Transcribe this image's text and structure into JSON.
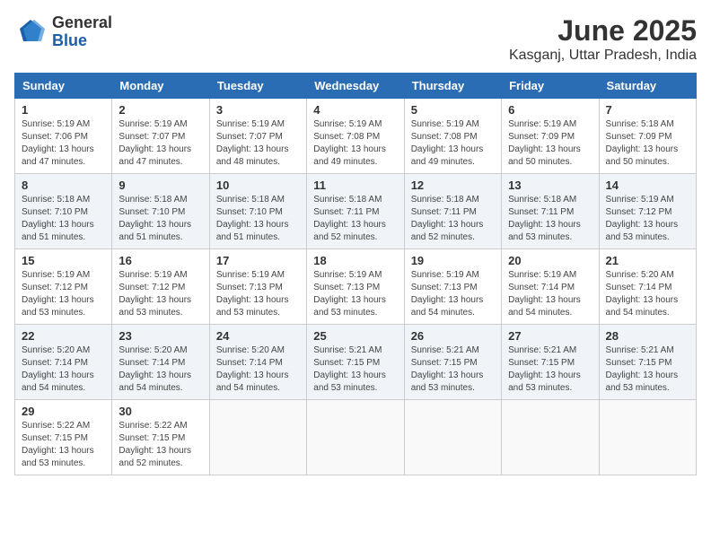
{
  "logo": {
    "general": "General",
    "blue": "Blue"
  },
  "title": {
    "month": "June 2025",
    "location": "Kasganj, Uttar Pradesh, India"
  },
  "headers": [
    "Sunday",
    "Monday",
    "Tuesday",
    "Wednesday",
    "Thursday",
    "Friday",
    "Saturday"
  ],
  "weeks": [
    [
      {
        "day": "1",
        "sunrise": "5:19 AM",
        "sunset": "7:06 PM",
        "daylight": "13 hours and 47 minutes."
      },
      {
        "day": "2",
        "sunrise": "5:19 AM",
        "sunset": "7:07 PM",
        "daylight": "13 hours and 47 minutes."
      },
      {
        "day": "3",
        "sunrise": "5:19 AM",
        "sunset": "7:07 PM",
        "daylight": "13 hours and 48 minutes."
      },
      {
        "day": "4",
        "sunrise": "5:19 AM",
        "sunset": "7:08 PM",
        "daylight": "13 hours and 49 minutes."
      },
      {
        "day": "5",
        "sunrise": "5:19 AM",
        "sunset": "7:08 PM",
        "daylight": "13 hours and 49 minutes."
      },
      {
        "day": "6",
        "sunrise": "5:19 AM",
        "sunset": "7:09 PM",
        "daylight": "13 hours and 50 minutes."
      },
      {
        "day": "7",
        "sunrise": "5:18 AM",
        "sunset": "7:09 PM",
        "daylight": "13 hours and 50 minutes."
      }
    ],
    [
      {
        "day": "8",
        "sunrise": "5:18 AM",
        "sunset": "7:10 PM",
        "daylight": "13 hours and 51 minutes."
      },
      {
        "day": "9",
        "sunrise": "5:18 AM",
        "sunset": "7:10 PM",
        "daylight": "13 hours and 51 minutes."
      },
      {
        "day": "10",
        "sunrise": "5:18 AM",
        "sunset": "7:10 PM",
        "daylight": "13 hours and 51 minutes."
      },
      {
        "day": "11",
        "sunrise": "5:18 AM",
        "sunset": "7:11 PM",
        "daylight": "13 hours and 52 minutes."
      },
      {
        "day": "12",
        "sunrise": "5:18 AM",
        "sunset": "7:11 PM",
        "daylight": "13 hours and 52 minutes."
      },
      {
        "day": "13",
        "sunrise": "5:18 AM",
        "sunset": "7:11 PM",
        "daylight": "13 hours and 53 minutes."
      },
      {
        "day": "14",
        "sunrise": "5:19 AM",
        "sunset": "7:12 PM",
        "daylight": "13 hours and 53 minutes."
      }
    ],
    [
      {
        "day": "15",
        "sunrise": "5:19 AM",
        "sunset": "7:12 PM",
        "daylight": "13 hours and 53 minutes."
      },
      {
        "day": "16",
        "sunrise": "5:19 AM",
        "sunset": "7:12 PM",
        "daylight": "13 hours and 53 minutes."
      },
      {
        "day": "17",
        "sunrise": "5:19 AM",
        "sunset": "7:13 PM",
        "daylight": "13 hours and 53 minutes."
      },
      {
        "day": "18",
        "sunrise": "5:19 AM",
        "sunset": "7:13 PM",
        "daylight": "13 hours and 53 minutes."
      },
      {
        "day": "19",
        "sunrise": "5:19 AM",
        "sunset": "7:13 PM",
        "daylight": "13 hours and 54 minutes."
      },
      {
        "day": "20",
        "sunrise": "5:19 AM",
        "sunset": "7:14 PM",
        "daylight": "13 hours and 54 minutes."
      },
      {
        "day": "21",
        "sunrise": "5:20 AM",
        "sunset": "7:14 PM",
        "daylight": "13 hours and 54 minutes."
      }
    ],
    [
      {
        "day": "22",
        "sunrise": "5:20 AM",
        "sunset": "7:14 PM",
        "daylight": "13 hours and 54 minutes."
      },
      {
        "day": "23",
        "sunrise": "5:20 AM",
        "sunset": "7:14 PM",
        "daylight": "13 hours and 54 minutes."
      },
      {
        "day": "24",
        "sunrise": "5:20 AM",
        "sunset": "7:14 PM",
        "daylight": "13 hours and 54 minutes."
      },
      {
        "day": "25",
        "sunrise": "5:21 AM",
        "sunset": "7:15 PM",
        "daylight": "13 hours and 53 minutes."
      },
      {
        "day": "26",
        "sunrise": "5:21 AM",
        "sunset": "7:15 PM",
        "daylight": "13 hours and 53 minutes."
      },
      {
        "day": "27",
        "sunrise": "5:21 AM",
        "sunset": "7:15 PM",
        "daylight": "13 hours and 53 minutes."
      },
      {
        "day": "28",
        "sunrise": "5:21 AM",
        "sunset": "7:15 PM",
        "daylight": "13 hours and 53 minutes."
      }
    ],
    [
      {
        "day": "29",
        "sunrise": "5:22 AM",
        "sunset": "7:15 PM",
        "daylight": "13 hours and 53 minutes."
      },
      {
        "day": "30",
        "sunrise": "5:22 AM",
        "sunset": "7:15 PM",
        "daylight": "13 hours and 52 minutes."
      },
      null,
      null,
      null,
      null,
      null
    ]
  ]
}
